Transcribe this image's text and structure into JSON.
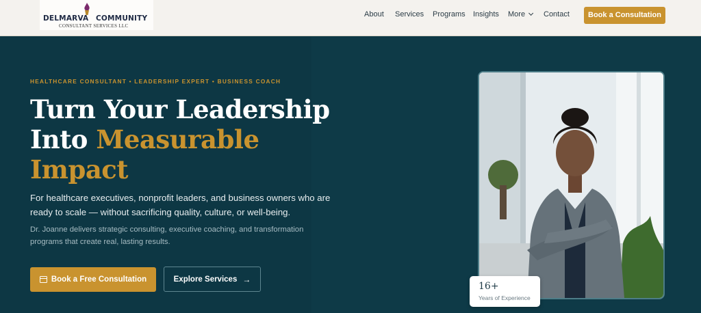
{
  "header": {
    "logo_text_left": "DELMARVA",
    "logo_text_right": "COMMUNITY",
    "logo_subtext": "CONSULTANT SERVICES LLC",
    "nav": [
      "About",
      "Services",
      "Programs",
      "Insights",
      "More",
      "Contact"
    ],
    "cta_label": "Book a Consultation"
  },
  "hero": {
    "eyebrow": "HEALTHCARE CONSULTANT • LEADERSHIP EXPERT • BUSINESS COACH",
    "headline_line1": "Turn Your Leadership",
    "headline_line2_white": "Into ",
    "headline_line2_gold": "Measurable",
    "headline_line3_gold": "Impact",
    "lead": "For healthcare executives, nonprofit leaders, and business owners who are ready to scale — without sacrificing quality, culture, or well-being.",
    "sub": "Dr. Joanne delivers strategic consulting, executive coaching, and transformation programs that create real, lasting results.",
    "primary_button": "Book a Free Consultation",
    "secondary_button": "Explore Services"
  },
  "badge": {
    "number": "16+",
    "label": "Years of Experience"
  },
  "icons": {
    "calendar": "calendar-icon",
    "arrow": "arrow-right-icon",
    "chevron": "chevron-down-icon",
    "flame": "torch-flame-icon"
  },
  "colors": {
    "background": "#0e3a47",
    "accent": "#c9932f",
    "header": "#f4f2ee"
  }
}
